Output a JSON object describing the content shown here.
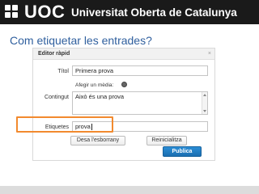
{
  "header": {
    "logo_text": "UOC",
    "institution": "Universitat Oberta de Catalunya"
  },
  "slide": {
    "heading": "Com etiquetar les entrades?"
  },
  "editor": {
    "title": "Editor ràpid",
    "close_icon": "×",
    "title_label": "Títol",
    "title_value": "Primera prova",
    "media_label": "Afegir un mèdia:",
    "content_label": "Contingut",
    "content_value": "Això és una prova",
    "tags_label": "Etiquetes",
    "tags_value": "prova",
    "save_draft_label": "Desa l'esborrany",
    "reset_label": "Reinicialitza",
    "publish_label": "Publica"
  },
  "colors": {
    "header_bg": "#1a1a1a",
    "heading_text": "#2f5f9e",
    "highlight_orange": "#f28a2e",
    "publish_blue": "#1a6eb0"
  },
  "icons": {
    "media": "media-icon",
    "close": "close-icon"
  }
}
